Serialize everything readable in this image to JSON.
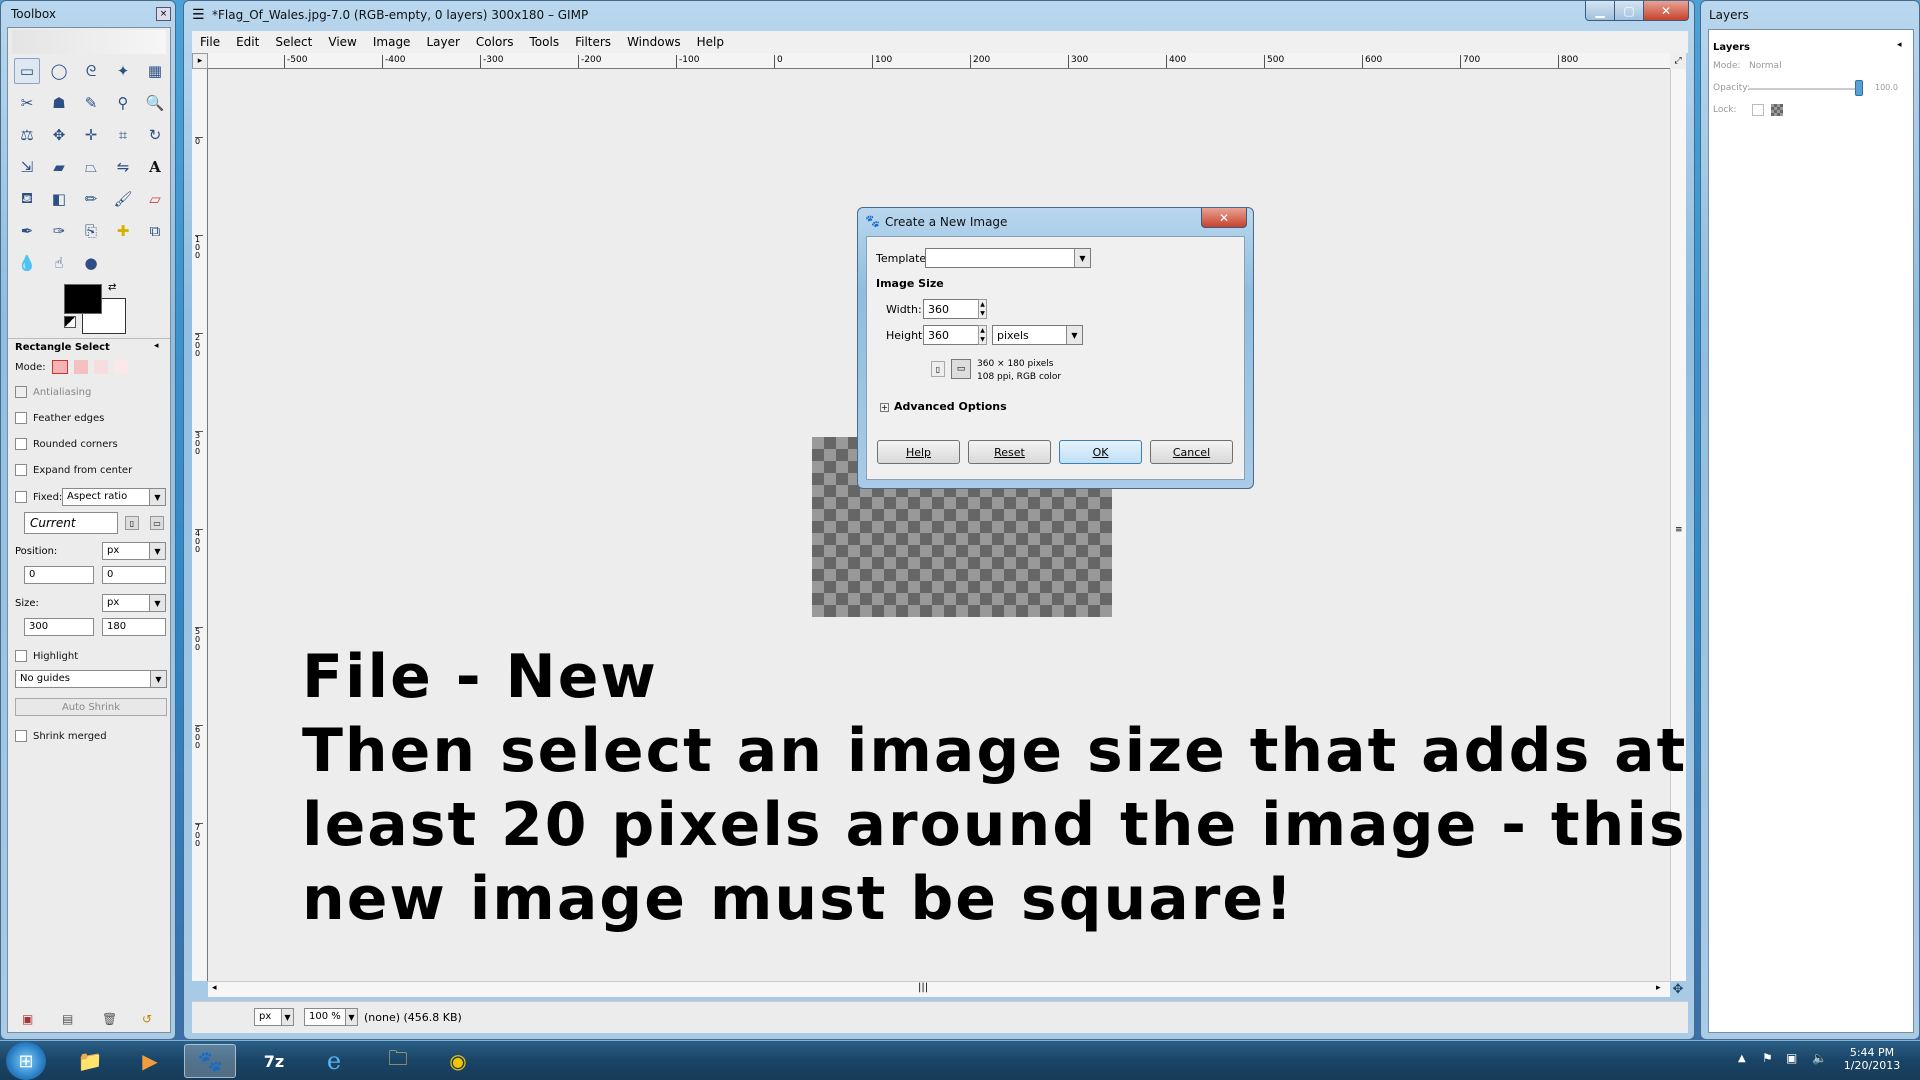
{
  "toolbox": {
    "title": "Toolbox",
    "tool_options_title": "Rectangle Select",
    "mode_label": "Mode:",
    "antialiasing": "Antialiasing",
    "feather_edges": "Feather edges",
    "rounded_corners": "Rounded corners",
    "expand_from_center": "Expand from center",
    "fixed_label": "Fixed:",
    "fixed_value": "Aspect ratio",
    "current_value": "Current",
    "position_label": "Position:",
    "position_unit": "px",
    "position_x": "0",
    "position_y": "0",
    "size_label": "Size:",
    "size_unit": "px",
    "size_w": "300",
    "size_h": "180",
    "highlight": "Highlight",
    "guides_value": "No guides",
    "auto_shrink": "Auto Shrink",
    "shrink_merged": "Shrink merged"
  },
  "mainwin": {
    "title": "*Flag_Of_Wales.jpg-7.0 (RGB-empty, 0 layers) 300x180 – GIMP",
    "menu": [
      "File",
      "Edit",
      "Select",
      "View",
      "Image",
      "Layer",
      "Colors",
      "Tools",
      "Filters",
      "Windows",
      "Help"
    ],
    "ruler_h_labels": [
      "-500",
      "-400",
      "-300",
      "-200",
      "-100",
      "0",
      "100",
      "200",
      "300",
      "400",
      "500",
      "600",
      "700",
      "800"
    ],
    "ruler_v_labels": [
      "0",
      "100",
      "200",
      "300",
      "400",
      "500",
      "600",
      "700"
    ],
    "status_unit": "px",
    "status_zoom": "100 %",
    "status_text": "(none) (456.8 KB)"
  },
  "dialog": {
    "title": "Create a New Image",
    "template_label": "Template:",
    "image_size_label": "Image Size",
    "width_label": "Width:",
    "width_value": "360",
    "height_label": "Height:",
    "height_value": "360",
    "unit_value": "pixels",
    "info_line1": "360 × 180 pixels",
    "info_line2": "108 ppi, RGB color",
    "advanced_options": "Advanced Options",
    "help_btn": "Help",
    "reset_btn": "Reset",
    "ok_btn": "OK",
    "cancel_btn": "Cancel"
  },
  "overlay": {
    "line1": "File - New",
    "line2": "Then select an image size that adds at",
    "line3": "least 20 pixels around the image - this",
    "line4": "new image must be square!"
  },
  "layers": {
    "title": "Layers",
    "tab_label": "Layers",
    "mode_label": "Mode:",
    "mode_value": "Normal",
    "opacity_label": "Opacity:",
    "opacity_value": "100.0",
    "lock_label": "Lock:"
  },
  "taskbar": {
    "time": "5:44 PM",
    "date": "1/20/2013"
  }
}
